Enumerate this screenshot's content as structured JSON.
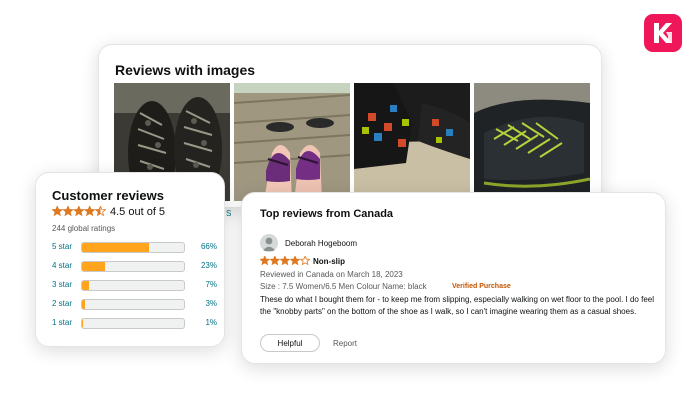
{
  "colors": {
    "brand": "#f0165a",
    "accent": "#ffa41c",
    "star": "#de7921",
    "link": "#007185",
    "verified": "#c45500"
  },
  "brand_logo": {
    "icon": "km-logo-icon"
  },
  "images_section": {
    "title": "Reviews with images",
    "images": [
      {
        "icon": "shoe-soles-photo"
      },
      {
        "icon": "purple-shoes-on-deck-photo"
      },
      {
        "icon": "black-shoes-on-carpet-photo"
      },
      {
        "icon": "black-shoe-closeup-photo"
      }
    ],
    "see_all_fragment": "S"
  },
  "summary": {
    "title": "Customer reviews",
    "rating": 4.5,
    "out_of_text": "4.5 out of 5",
    "global_ratings": "244 global ratings",
    "histogram": [
      {
        "label": "5 star",
        "percent": 66,
        "percent_text": "66%"
      },
      {
        "label": "4 star",
        "percent": 23,
        "percent_text": "23%"
      },
      {
        "label": "3 star",
        "percent": 7,
        "percent_text": "7%"
      },
      {
        "label": "2 star",
        "percent": 3,
        "percent_text": "3%"
      },
      {
        "label": "1 star",
        "percent": 1,
        "percent_text": "1%"
      }
    ]
  },
  "top_reviews": {
    "heading": "Top reviews from Canada",
    "review": {
      "reviewer": "Deborah Hogeboom",
      "rating": 4,
      "title": "Non-slip",
      "meta": "Reviewed in Canada on March 18, 2023",
      "size": "Size : 7.5 Women/6.5 Men    Colour Name: black",
      "verified": "Verified Purchase",
      "body": "These do what I bought them for - to keep me from slipping, especially walking on wet floor to the pool. I do feel the \"knobby parts\" on the bottom of the shoe as I walk, so I can't imagine wearing them as a casual shoes.",
      "helpful_label": "Helpful",
      "report_label": "Report"
    }
  }
}
